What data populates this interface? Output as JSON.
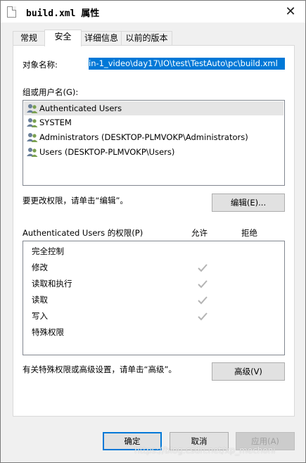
{
  "window": {
    "title": "build.xml 属性",
    "close_glyph": "✕"
  },
  "tabs": [
    {
      "label": "常规",
      "active": false
    },
    {
      "label": "安全",
      "active": true
    },
    {
      "label": "详细信息",
      "active": false
    },
    {
      "label": "以前的版本",
      "active": false
    }
  ],
  "object": {
    "label": "对象名称:",
    "value": "in-1_video\\day17\\IO\\test\\TestAuto\\pc\\build.xml"
  },
  "groups": {
    "label": "组或用户名(G):",
    "items": [
      {
        "label": "Authenticated Users",
        "icon": "users-icon",
        "selected": true
      },
      {
        "label": "SYSTEM",
        "icon": "users-icon",
        "selected": false
      },
      {
        "label": "Administrators (DESKTOP-PLMVOKP\\Administrators)",
        "icon": "users-icon",
        "selected": false
      },
      {
        "label": "Users (DESKTOP-PLMVOKP\\Users)",
        "icon": "users-icon",
        "selected": false
      }
    ]
  },
  "change": {
    "label": "要更改权限，请单击“编辑”。",
    "edit_button": "编辑(E)..."
  },
  "permissions": {
    "title": "Authenticated Users 的权限(P)",
    "allow_header": "允许",
    "deny_header": "拒绝",
    "rows": [
      {
        "label": "完全控制",
        "allow": false
      },
      {
        "label": "修改",
        "allow": true
      },
      {
        "label": "读取和执行",
        "allow": true
      },
      {
        "label": "读取",
        "allow": true
      },
      {
        "label": "写入",
        "allow": true
      },
      {
        "label": "特殊权限",
        "allow": false
      }
    ]
  },
  "advanced": {
    "label": "有关特殊权限或高级设置，请单击“高级”。",
    "button": "高级(V)"
  },
  "footer": {
    "ok": "确定",
    "cancel": "取消",
    "apply": "应用(A)"
  },
  "watermark": "https://blog.csdn.net/xp_mechoni",
  "colors": {
    "selection": "#0078d7",
    "check": "#b4b4b4"
  }
}
